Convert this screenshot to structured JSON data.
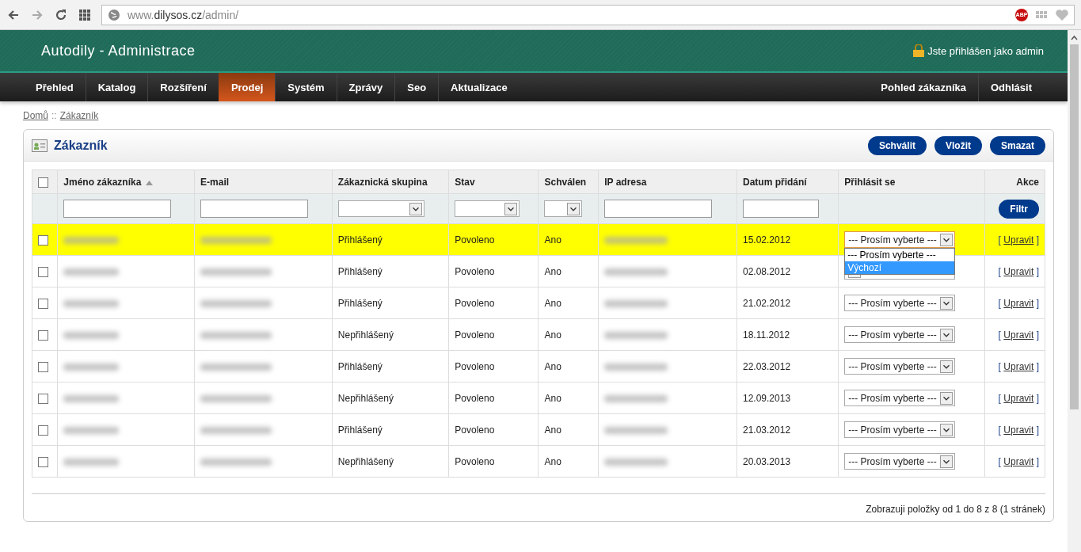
{
  "browser": {
    "url_host": "www.",
    "url_domain": "dilysos.cz",
    "url_path": "/admin/",
    "extension_badge": "ABP"
  },
  "header": {
    "title": "Autodily - Administrace",
    "login_status": "Jste přihlášen jako admin"
  },
  "nav": {
    "left": [
      {
        "label": "Přehled",
        "selected": false
      },
      {
        "label": "Katalog",
        "selected": false
      },
      {
        "label": "Rozšíření",
        "selected": false
      },
      {
        "label": "Prodej",
        "selected": true
      },
      {
        "label": "Systém",
        "selected": false
      },
      {
        "label": "Zprávy",
        "selected": false
      },
      {
        "label": "Seo",
        "selected": false
      },
      {
        "label": "Aktualizace",
        "selected": false
      }
    ],
    "right": [
      {
        "label": "Pohled zákazníka",
        "selected": false
      },
      {
        "label": "Odhlásit",
        "selected": false
      }
    ]
  },
  "breadcrumbs": [
    "Domů",
    "Zákazník"
  ],
  "breadcrumb_separator": "::",
  "panel": {
    "title": "Zákazník",
    "buttons": [
      "Schválit",
      "Vložit",
      "Smazat"
    ]
  },
  "table": {
    "select_all_checked": false,
    "columns": [
      {
        "label": "Jméno zákazníka",
        "sorted": true,
        "kind": "text"
      },
      {
        "label": "E-mail",
        "sorted": false,
        "kind": "text"
      },
      {
        "label": "Zákaznická skupina",
        "sorted": false,
        "kind": "select"
      },
      {
        "label": "Stav",
        "sorted": false,
        "kind": "select"
      },
      {
        "label": "Schválen",
        "sorted": false,
        "kind": "select"
      },
      {
        "label": "IP adresa",
        "sorted": false,
        "kind": "text"
      },
      {
        "label": "Datum přidání",
        "sorted": false,
        "kind": "text"
      },
      {
        "label": "Přihlásit se",
        "sorted": false,
        "kind": "none"
      },
      {
        "label": "Akce",
        "sorted": false,
        "kind": "button"
      }
    ],
    "filter_button": "Filtr",
    "rows": [
      {
        "selected": true,
        "checked": false,
        "group": "Přihlášený",
        "status": "Povoleno",
        "approved": "Ano",
        "date": "15.02.2012",
        "login": "--- Prosím vyberte ---",
        "login_open": true,
        "action_open": "[",
        "action": "Upravit",
        "action_close": "]"
      },
      {
        "selected": false,
        "checked": false,
        "group": "Přihlášený",
        "status": "Povoleno",
        "approved": "Ano",
        "date": "02.08.2012",
        "login_open": false,
        "action_open": "[",
        "action": "Upravit",
        "action_close": "]"
      },
      {
        "selected": false,
        "checked": false,
        "group": "Přihlášený",
        "status": "Povoleno",
        "approved": "Ano",
        "date": "21.02.2012",
        "login": "--- Prosím vyberte ---",
        "login_open": false,
        "action_open": "[",
        "action": "Upravit",
        "action_close": "]"
      },
      {
        "selected": false,
        "checked": false,
        "group": "Nepřihlášený",
        "status": "Povoleno",
        "approved": "Ano",
        "date": "18.11.2012",
        "login": "--- Prosím vyberte ---",
        "login_open": false,
        "action_open": "[",
        "action": "Upravit",
        "action_close": "]"
      },
      {
        "selected": false,
        "checked": false,
        "group": "Přihlášený",
        "status": "Povoleno",
        "approved": "Ano",
        "date": "22.03.2012",
        "login": "--- Prosím vyberte ---",
        "login_open": false,
        "action_open": "[",
        "action": "Upravit",
        "action_close": "]"
      },
      {
        "selected": false,
        "checked": false,
        "group": "Nepřihlášený",
        "status": "Povoleno",
        "approved": "Ano",
        "date": "12.09.2013",
        "login": "--- Prosím vyberte ---",
        "login_open": false,
        "action_open": "[",
        "action": "Upravit",
        "action_close": "]"
      },
      {
        "selected": false,
        "checked": false,
        "group": "Přihlášený",
        "status": "Povoleno",
        "approved": "Ano",
        "date": "21.03.2012",
        "login": "--- Prosím vyberte ---",
        "login_open": false,
        "action_open": "[",
        "action": "Upravit",
        "action_close": "]"
      },
      {
        "selected": false,
        "checked": false,
        "group": "Nepřihlášený",
        "status": "Povoleno",
        "approved": "Ano",
        "date": "20.03.2013",
        "login": "--- Prosím vyberte ---",
        "login_open": false,
        "action_open": "[",
        "action": "Upravit",
        "action_close": "]"
      }
    ],
    "login_options": [
      {
        "label": "--- Prosím vyberte ---",
        "selected": false
      },
      {
        "label": "Výchozí",
        "selected": true
      }
    ],
    "pagination": "Zobrazuji položky od 1 do 8 z 8 (1 stránek)"
  }
}
